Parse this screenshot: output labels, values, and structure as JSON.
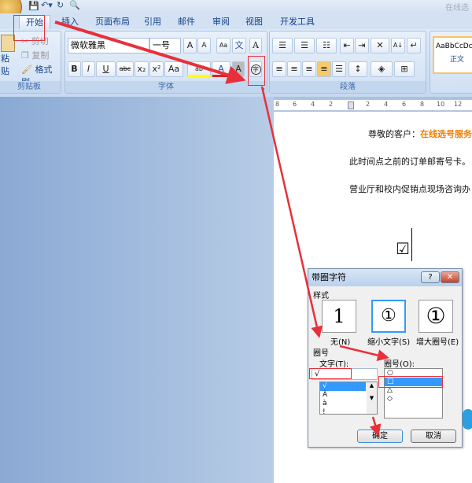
{
  "window": {
    "title": "在线选"
  },
  "tabs": [
    "开始",
    "插入",
    "页面布局",
    "引用",
    "邮件",
    "审阅",
    "视图",
    "开发工具"
  ],
  "clipboard": {
    "paste": "粘贴",
    "cut": "剪切",
    "copy": "复制",
    "format_painter": "格式刷",
    "label": "剪贴板"
  },
  "font": {
    "name": "微软雅黑",
    "size": "一号",
    "label": "字体",
    "bold": "B",
    "italic": "I",
    "underline": "U",
    "strike": "abc",
    "sub": "x₂",
    "sup": "x²",
    "case": "Aa",
    "enclose": "字"
  },
  "paragraph": {
    "label": "段落"
  },
  "styles": {
    "preview": "AaBbCcDc",
    "name": "正文"
  },
  "ruler": [
    "8",
    "6",
    "4",
    "2",
    "2",
    "4",
    "6",
    "8",
    "10",
    "12"
  ],
  "document": {
    "line1_prefix": "尊敬的客户：",
    "line1_highlight": "在线选号服务",
    "line2": "此时间点之前的订单邮寄号卡。",
    "line3": "营业厅和校内促销点现场咨询办",
    "symbol": "☑"
  },
  "colors": {
    "highlight": "#f07d00",
    "annotation": "#e8303a",
    "selection": "#3399ff"
  },
  "dialog": {
    "title": "带圈字符",
    "help": "?",
    "close": "✕",
    "style_section": "样式",
    "styles": [
      {
        "glyph": "1",
        "label": "无(N)"
      },
      {
        "glyph": "①",
        "label": "缩小文字(S)",
        "selected": true
      },
      {
        "glyph": "①",
        "label": "增大圈号(E)"
      }
    ],
    "enclosure_section": "圈号",
    "text_label": "文字(T):",
    "text_value": "√",
    "text_options": [
      "√",
      "À",
      "à",
      "!"
    ],
    "circle_label": "圈号(O):",
    "circle_options": [
      "○",
      "□",
      "△",
      "◇"
    ],
    "circle_selected": "□",
    "ok": "确定",
    "cancel": "取消"
  }
}
